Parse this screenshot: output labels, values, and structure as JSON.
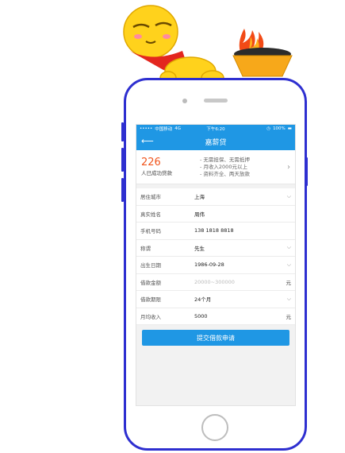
{
  "status_bar": {
    "carrier": "中国移动",
    "network": "4G",
    "time": "下午6:20",
    "battery": "100%"
  },
  "nav": {
    "back_icon": "back-arrow-icon",
    "title": "嘉薪贷"
  },
  "promo": {
    "count": "226",
    "count_label": "人已成功贷款",
    "features": [
      "- 无需担保、无需抵押",
      "- 月收入2000元以上",
      "- 资料齐全、两天放款"
    ]
  },
  "form": {
    "rows": [
      {
        "label": "居住城市",
        "value": "上海",
        "control": "dropdown"
      },
      {
        "label": "真实姓名",
        "value": "周伟",
        "control": "text"
      },
      {
        "label": "手机号码",
        "value": "138 1818 8818",
        "control": "text"
      },
      {
        "label": "称谓",
        "value": "先生",
        "control": "dropdown"
      },
      {
        "label": "出生日期",
        "value": "1986-09-28",
        "control": "dropdown"
      },
      {
        "label": "借款金额",
        "placeholder": "20000~300000",
        "suffix": "元",
        "control": "input"
      },
      {
        "label": "借款期限",
        "value": "24个月",
        "control": "dropdown"
      },
      {
        "label": "月均收入",
        "value": "5000",
        "suffix": "元",
        "control": "input"
      }
    ]
  },
  "submit_label": "提交借款申请",
  "colors": {
    "brand_blue": "#1f97e4",
    "accent_orange": "#f0551d",
    "phone_frame": "#2e2fd0"
  }
}
